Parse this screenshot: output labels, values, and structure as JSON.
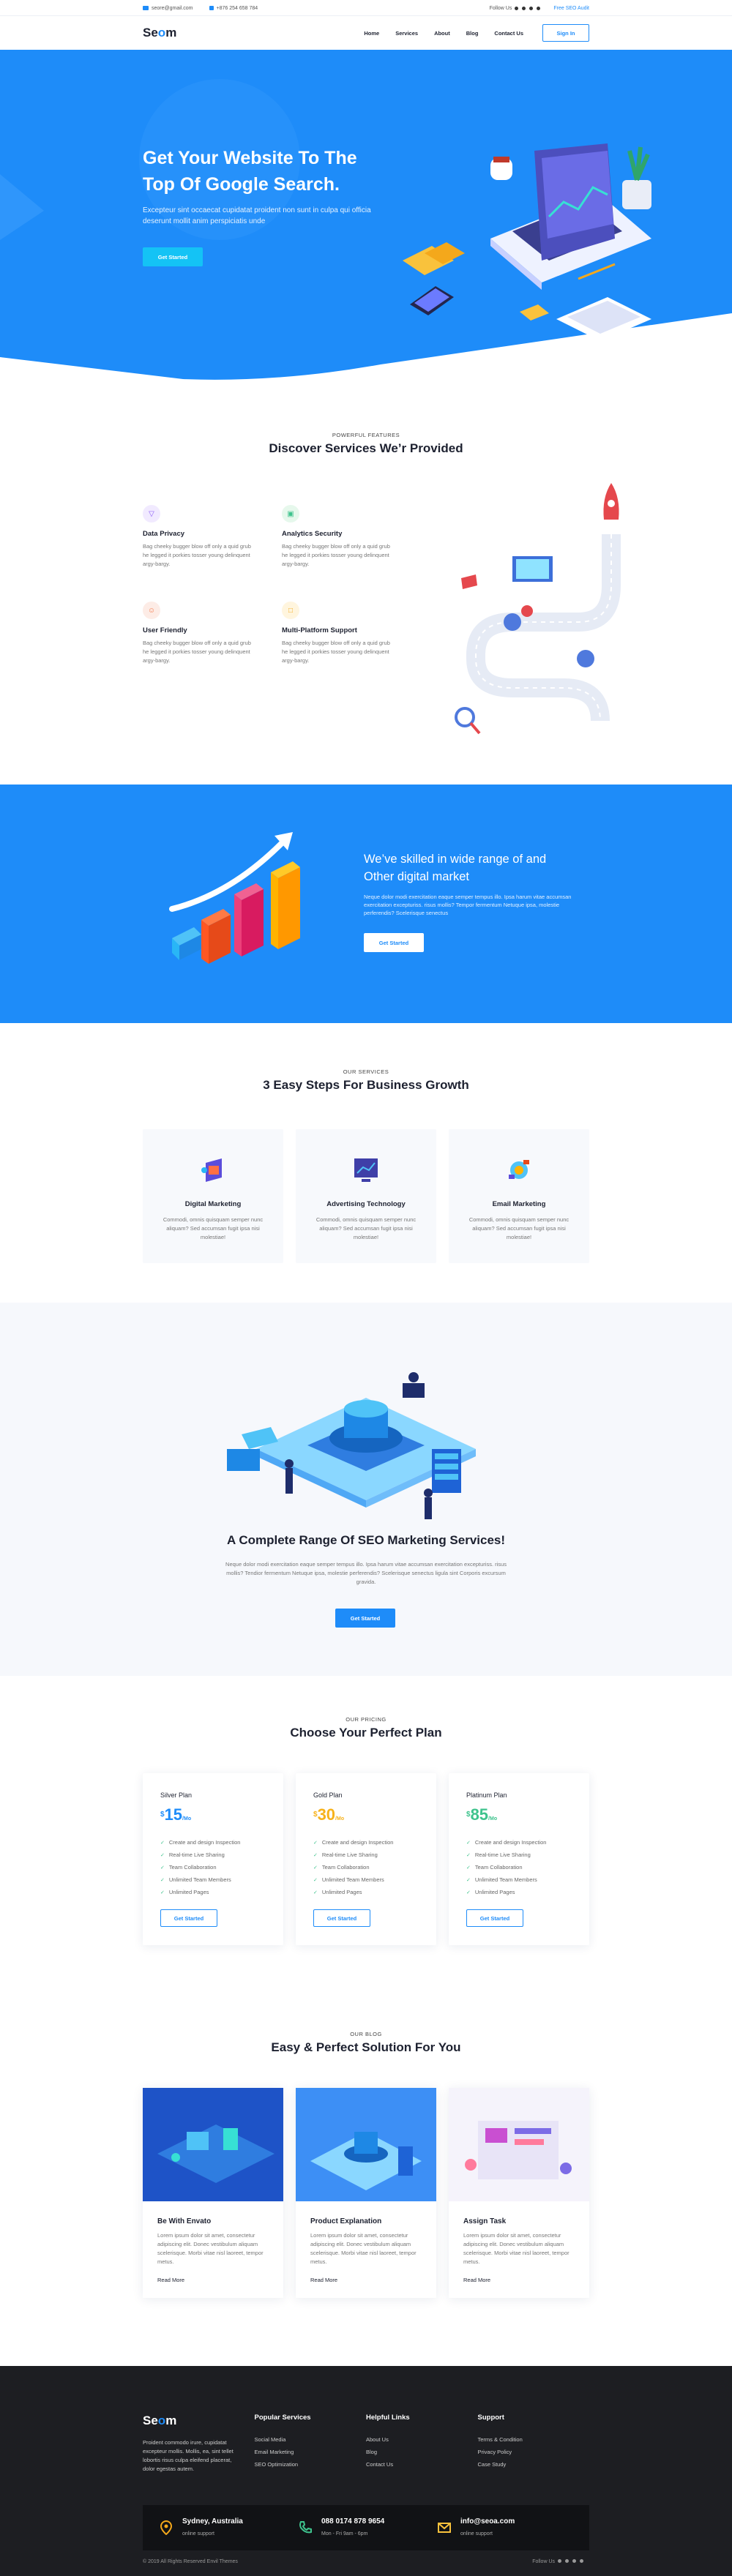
{
  "topbar": {
    "email": "seore@gmail.com",
    "phone": "+876 254 658 784",
    "follow": "Follow Us",
    "free_audit": "Free SEO Audit"
  },
  "nav": {
    "logo_a": "Se",
    "logo_b": "o",
    "logo_c": "m",
    "items": [
      "Home",
      "Services",
      "About",
      "Blog",
      "Contact Us"
    ],
    "signin": "Sign In"
  },
  "hero": {
    "title": "Get Your Website To The Top Of Google Search.",
    "text": "Excepteur sint occaecat cupidatat proident non sunt in culpa qui officia deserunt mollit anim perspiciatis unde",
    "button": "Get Started"
  },
  "features": {
    "kicker": "POWERFUL FEATURES",
    "title": "Discover Services We’r Provided",
    "items": [
      {
        "title": "Data Privacy",
        "text": "Bag cheeky bugger blow off only a quid grub he legged it porkies tosser young delinquent argy-bargy."
      },
      {
        "title": "Analytics Security",
        "text": "Bag cheeky bugger blow off only a quid grub he legged it porkies tosser young delinquent argy-bargy."
      },
      {
        "title": "User Friendly",
        "text": "Bag cheeky bugger blow off only a quid grub he legged it porkies tosser young delinquent argy-bargy."
      },
      {
        "title": "Multi-Platform Support",
        "text": "Bag cheeky bugger blow off only a quid grub he legged it porkies tosser young delinquent argy-bargy."
      }
    ]
  },
  "skilled": {
    "title": "We’ve skilled in wide range of and Other digital market",
    "text": "Neque dolor modi exercitation eaque semper tempus illo. Ipsa harum vitae accumsan exercitation excepturiss. risus mollis? Tempor fermentum Netuque ipsa, molestie perferendis? Scelerisque senectus",
    "button": "Get Started"
  },
  "steps": {
    "kicker": "OUR SERVICES",
    "title": "3 Easy Steps For Business Growth",
    "items": [
      {
        "title": "Digital Marketing",
        "text": "Commodi, omnis quisquam semper nunc aliquam? Sed accumsan fugit ipsa nisi molestiae!"
      },
      {
        "title": "Advertising Technology",
        "text": "Commodi, omnis quisquam semper nunc aliquam? Sed accumsan fugit ipsa nisi molestiae!"
      },
      {
        "title": "Email Marketing",
        "text": "Commodi, omnis quisquam semper nunc aliquam? Sed accumsan fugit ipsa nisi molestiae!"
      }
    ]
  },
  "range": {
    "title": "A Complete Range Of SEO Marketing Services!",
    "text": "Neque dolor modi exercitation eaque semper tempus illo. Ipsa harum vitae accumsan exercitation excepturiss. risus mollis? Tendior fermentum Netuque ipsa, molestie perferendis? Scelerisque senectus ligula sint Corporis excursum gravida.",
    "button": "Get Started"
  },
  "pricing": {
    "kicker": "OUR PRICING",
    "title": "Choose Your Perfect Plan",
    "plans": [
      {
        "name": "Silver Plan",
        "currency": "$",
        "amount": "15",
        "period": "/Mo",
        "color": "#1e8cf9"
      },
      {
        "name": "Gold Plan",
        "currency": "$",
        "amount": "30",
        "period": "/Mo",
        "color": "#f7b21b"
      },
      {
        "name": "Platinum Plan",
        "currency": "$",
        "amount": "85",
        "period": "/Mo",
        "color": "#3ec38d"
      }
    ],
    "features": [
      "Create and design Inspection",
      "Real-time Live Sharing",
      "Team Collaboration",
      "Unlimited Team Members",
      "Unlimited Pages"
    ],
    "button": "Get Started"
  },
  "blog": {
    "kicker": "OUR BLOG",
    "title": "Easy & Perfect Solution For You",
    "posts": [
      {
        "title": "Be With Envato",
        "text": "Lorem ipsum dolor sit amet, consectetur adipiscing elit. Donec vestibulum aliquam scelerisque. Morbi vitae nisl laoreet, tempor metus.",
        "more": "Read More"
      },
      {
        "title": "Product Explanation",
        "text": "Lorem ipsum dolor sit amet, consectetur adipiscing elit. Donec vestibulum aliquam scelerisque. Morbi vitae nisl laoreet, tempor metus.",
        "more": "Read More"
      },
      {
        "title": "Assign Task",
        "text": "Lorem ipsum dolor sit amet, consectetur adipiscing elit. Donec vestibulum aliquam scelerisque. Morbi vitae nisl laoreet, tempor metus.",
        "more": "Read More"
      }
    ]
  },
  "footer": {
    "about": "Proident commodo irure, cupidatat excepteur mollis. Mollis, ea, sint tellet lobortis risus culpa eleifend placerat, dolor egestas autem.",
    "cols": [
      {
        "title": "Popular Services",
        "links": [
          "Social Media",
          "Email Marketing",
          "SEO Optimization"
        ]
      },
      {
        "title": "Helpful Links",
        "links": [
          "About Us",
          "Blog",
          "Contact Us"
        ]
      },
      {
        "title": "Support",
        "links": [
          "Terms & Condition",
          "Privacy Policy",
          "Case Study"
        ]
      }
    ],
    "contact": [
      {
        "main": "Sydney, Australia",
        "sub": "online support"
      },
      {
        "main": "088 0174 878 9654",
        "sub": "Mon - Fri 9am - 6pm"
      },
      {
        "main": "info@seoa.com",
        "sub": "online support"
      }
    ],
    "copyright": "© 2019 All Rights Reserved Envil Themes",
    "follow": "Follow Us"
  }
}
